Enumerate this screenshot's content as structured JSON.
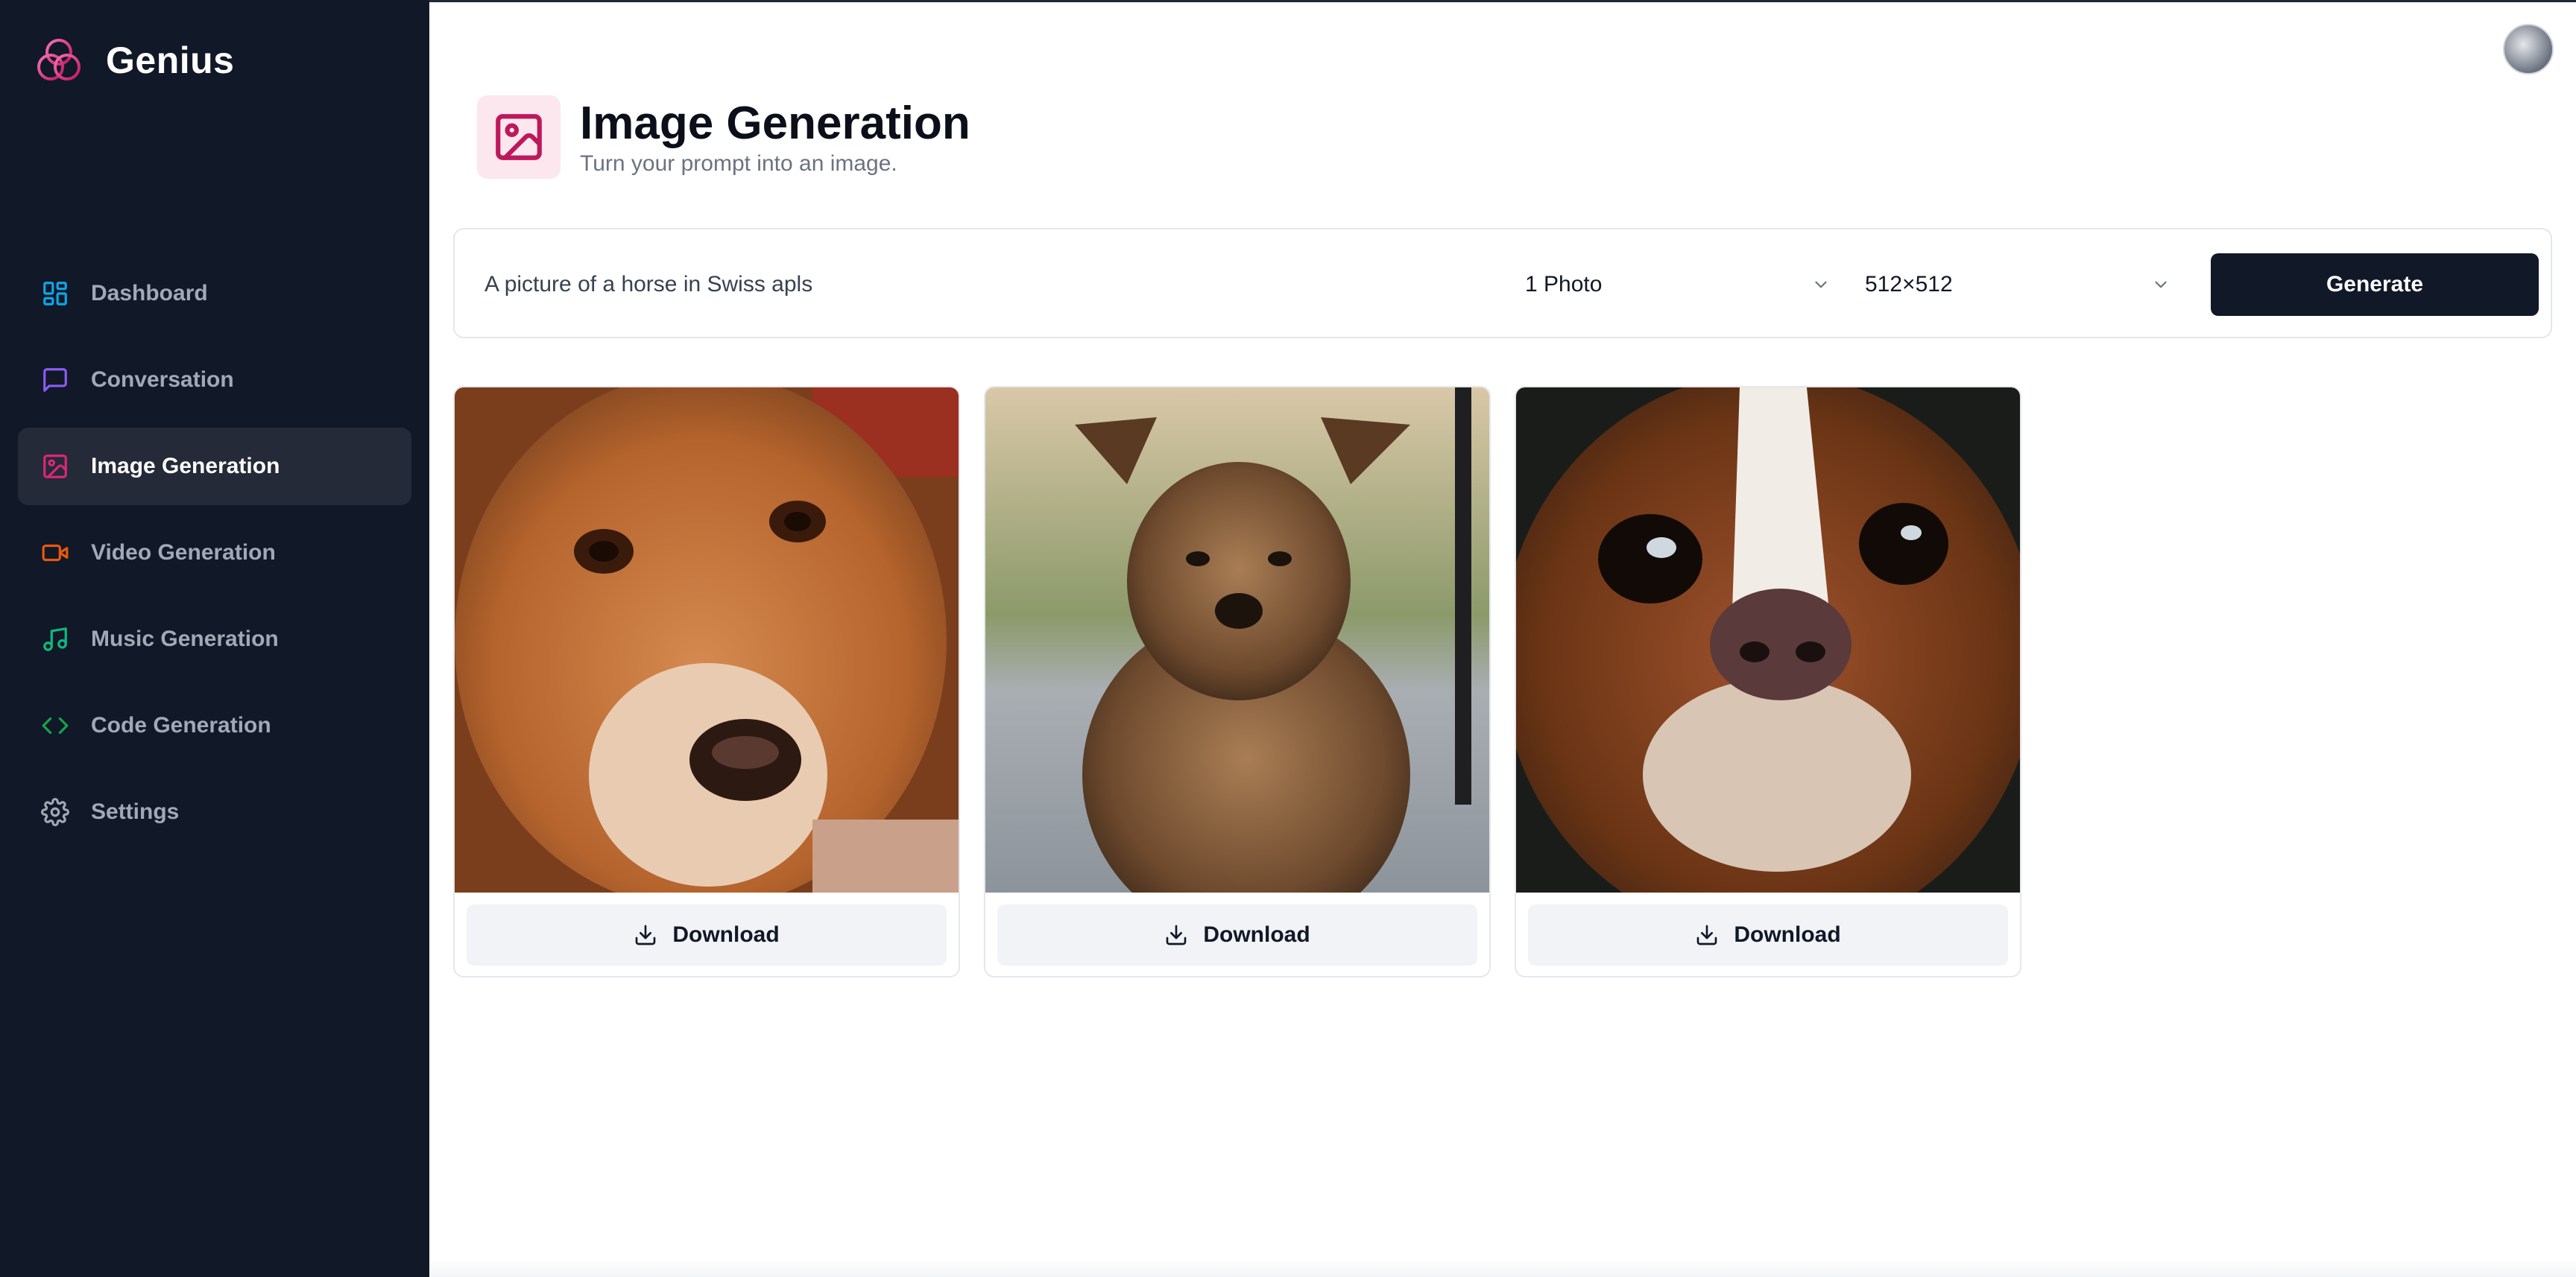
{
  "brand": {
    "name": "Genius"
  },
  "sidebar": {
    "items": [
      {
        "label": "Dashboard",
        "icon": "layout-dashboard-icon",
        "color": "#0ea5e9",
        "active": false
      },
      {
        "label": "Conversation",
        "icon": "message-square-icon",
        "color": "#8b5cf6",
        "active": false
      },
      {
        "label": "Image Generation",
        "icon": "image-icon",
        "color": "#db2777",
        "active": true
      },
      {
        "label": "Video Generation",
        "icon": "video-icon",
        "color": "#ea580c",
        "active": false
      },
      {
        "label": "Music Generation",
        "icon": "music-icon",
        "color": "#10b981",
        "active": false
      },
      {
        "label": "Code Generation",
        "icon": "code-icon",
        "color": "#16a34a",
        "active": false
      },
      {
        "label": "Settings",
        "icon": "settings-icon",
        "color": "#a1a8b6",
        "active": false
      }
    ]
  },
  "header": {
    "title": "Image Generation",
    "subtitle": "Turn your prompt into an image.",
    "icon": "image-icon",
    "icon_color": "#be185d"
  },
  "form": {
    "prompt_value": "A picture of a horse in Swiss apls",
    "amount_value": "1 Photo",
    "resolution_value": "512×512",
    "generate_label": "Generate"
  },
  "results": [
    {
      "subject": "light brown dog close-up",
      "download_label": "Download"
    },
    {
      "subject": "small brown dog outdoors",
      "download_label": "Download"
    },
    {
      "subject": "spaniel face close-up",
      "download_label": "Download"
    }
  ],
  "colors": {
    "sidebar_bg": "#111827",
    "accent_dark": "#111827",
    "image_accent": "#db2777"
  }
}
